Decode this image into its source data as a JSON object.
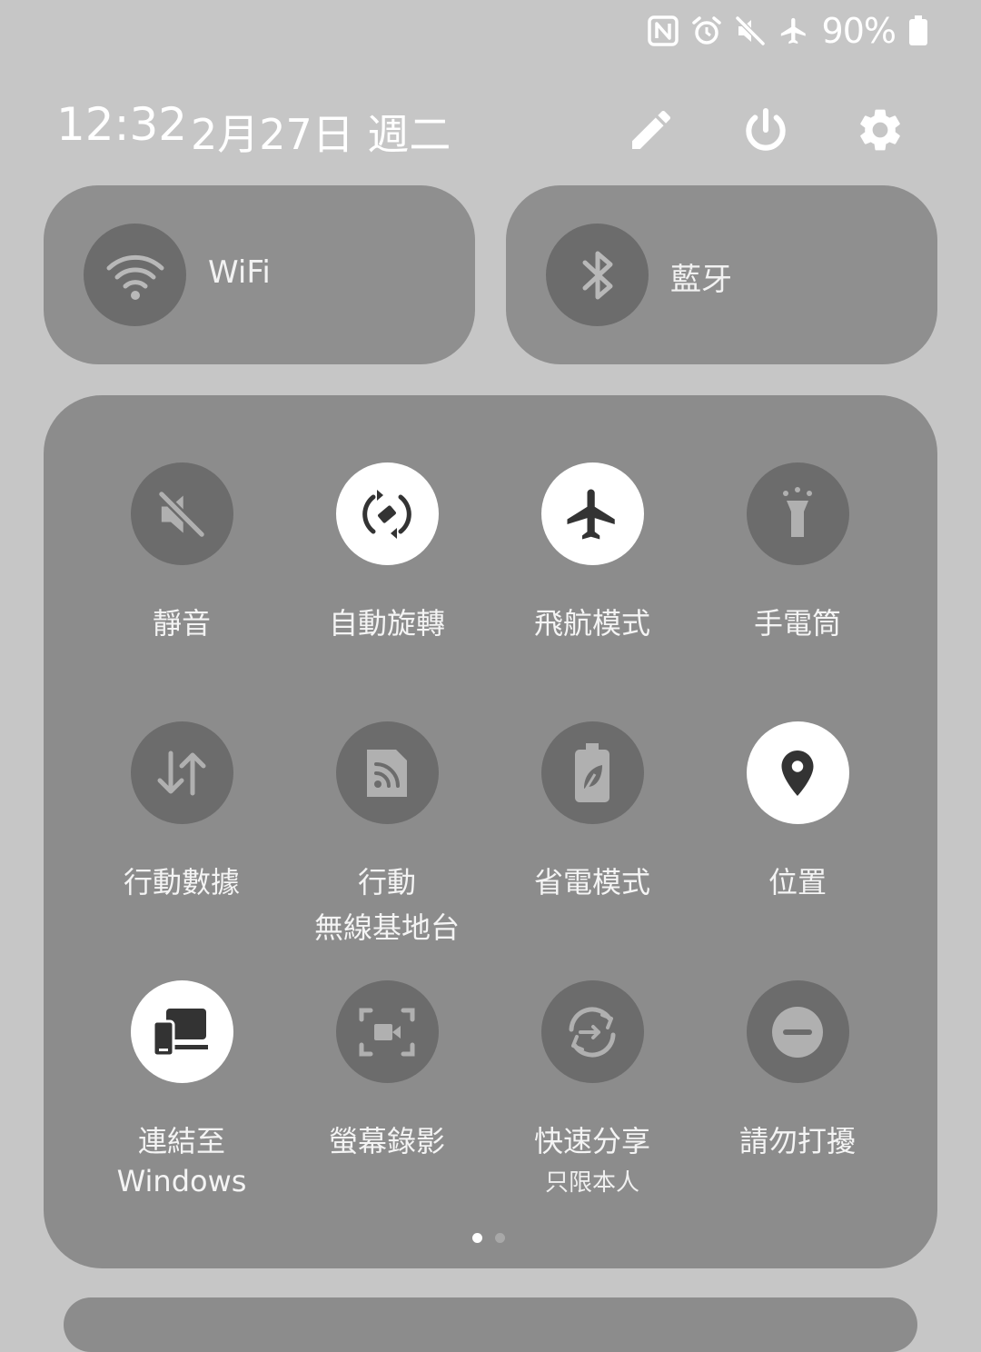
{
  "status_bar": {
    "battery_percent": "90%",
    "icons": [
      "nfc-icon",
      "alarm-icon",
      "mute-icon",
      "airplane-icon",
      "battery-icon"
    ]
  },
  "header": {
    "time": "12:32",
    "date": "2月27日 週二",
    "buttons": [
      "edit-icon",
      "power-icon",
      "settings-icon"
    ]
  },
  "big_tiles": [
    {
      "label": "WiFi",
      "icon": "wifi-icon",
      "active": false
    },
    {
      "label": "藍牙",
      "icon": "bluetooth-icon",
      "active": false
    }
  ],
  "tiles": [
    {
      "label": "靜音",
      "icon": "mute-icon",
      "active": false
    },
    {
      "label": "自動旋轉",
      "icon": "auto-rotate-icon",
      "active": true
    },
    {
      "label": "飛航模式",
      "icon": "airplane-icon",
      "active": true
    },
    {
      "label": "手電筒",
      "icon": "flashlight-icon",
      "active": false
    },
    {
      "label": "行動數據",
      "icon": "mobile-data-icon",
      "active": false
    },
    {
      "label": "行動",
      "label2": "無線基地台",
      "icon": "hotspot-icon",
      "active": false
    },
    {
      "label": "省電模式",
      "icon": "power-saving-icon",
      "active": false
    },
    {
      "label": "位置",
      "icon": "location-icon",
      "active": true
    },
    {
      "label": "連結至",
      "label2": "Windows",
      "icon": "link-to-windows-icon",
      "active": true
    },
    {
      "label": "螢幕錄影",
      "icon": "screen-record-icon",
      "active": false
    },
    {
      "label": "快速分享",
      "sub": "只限本人",
      "icon": "quick-share-icon",
      "active": false
    },
    {
      "label": "請勿打擾",
      "icon": "do-not-disturb-icon",
      "active": false
    }
  ],
  "pagination": {
    "pages": 2,
    "current": 1
  },
  "colors": {
    "background": "#c6c6c6",
    "tile_bg": "#8c8c8c",
    "circle_off": "#6c6c6c",
    "circle_on": "#ffffff"
  }
}
